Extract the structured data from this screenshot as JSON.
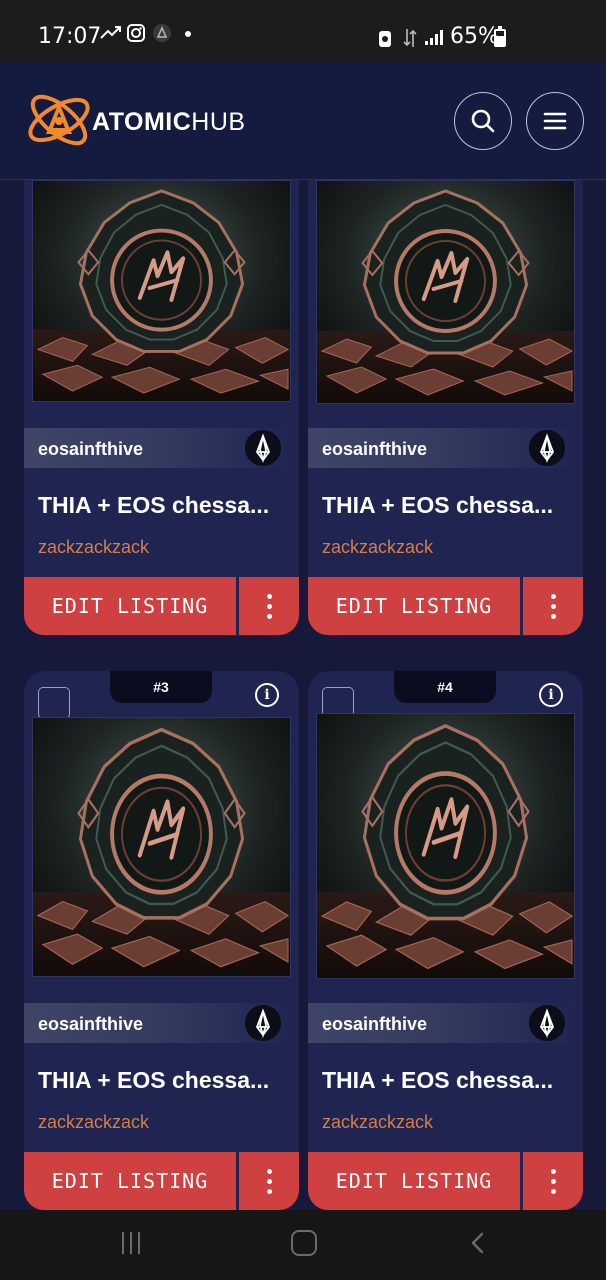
{
  "status": {
    "time": "17:07",
    "battery_text": "65%",
    "battery_level": 0.65
  },
  "header": {
    "brand_bold": "ATOMIC",
    "brand_light": "HUB",
    "search_icon": "search-icon",
    "menu_icon": "hamburger-menu-icon"
  },
  "cards": [
    {
      "number": "",
      "collection": "eosainfthive",
      "title": "THIA + EOS chessa...",
      "owner": "zackzackzack",
      "edit_label": "EDIT LISTING"
    },
    {
      "number": "",
      "collection": "eosainfthive",
      "title": "THIA + EOS chessa...",
      "owner": "zackzackzack",
      "edit_label": "EDIT LISTING"
    },
    {
      "number": "#3",
      "collection": "eosainfthive",
      "title": "THIA + EOS chessa...",
      "owner": "zackzackzack",
      "edit_label": "EDIT LISTING"
    },
    {
      "number": "#4",
      "collection": "eosainfthive",
      "title": "THIA + EOS chessa...",
      "owner": "zackzackzack",
      "edit_label": "EDIT LISTING"
    }
  ],
  "colors": {
    "accent": "#cf4040",
    "owner": "#d57e48",
    "background": "#16193a",
    "card": "#1f2450"
  }
}
